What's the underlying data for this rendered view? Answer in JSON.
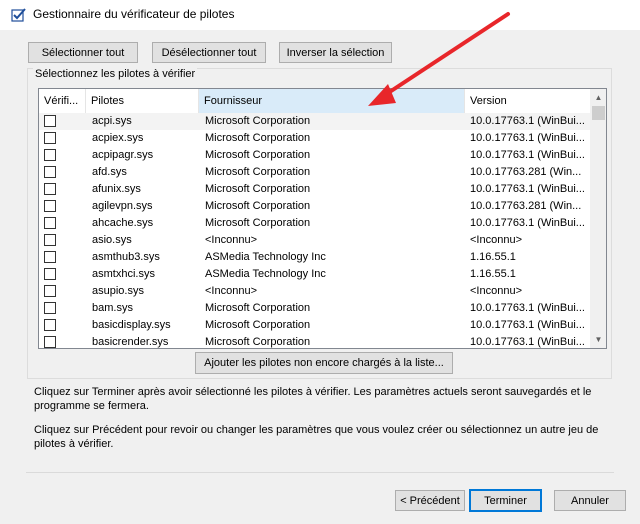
{
  "window": {
    "title": "Gestionnaire du vérificateur de pilotes"
  },
  "toolbar": {
    "select_all": "Sélectionner tout",
    "deselect_all": "Désélectionner tout",
    "invert": "Inverser la sélection"
  },
  "group": {
    "label": "Sélectionnez les pilotes à vérifier"
  },
  "table": {
    "columns": [
      "Vérifi...",
      "Pilotes",
      "Fournisseur",
      "Version"
    ],
    "rows": [
      {
        "checked": false,
        "driver": "acpi.sys",
        "vendor": "Microsoft Corporation",
        "version": "10.0.17763.1 (WinBui..."
      },
      {
        "checked": false,
        "driver": "acpiex.sys",
        "vendor": "Microsoft Corporation",
        "version": "10.0.17763.1 (WinBui..."
      },
      {
        "checked": false,
        "driver": "acpipagr.sys",
        "vendor": "Microsoft Corporation",
        "version": "10.0.17763.1 (WinBui..."
      },
      {
        "checked": false,
        "driver": "afd.sys",
        "vendor": "Microsoft Corporation",
        "version": "10.0.17763.281 (Win..."
      },
      {
        "checked": false,
        "driver": "afunix.sys",
        "vendor": "Microsoft Corporation",
        "version": "10.0.17763.1 (WinBui..."
      },
      {
        "checked": false,
        "driver": "agilevpn.sys",
        "vendor": "Microsoft Corporation",
        "version": "10.0.17763.281 (Win..."
      },
      {
        "checked": false,
        "driver": "ahcache.sys",
        "vendor": "Microsoft Corporation",
        "version": "10.0.17763.1 (WinBui..."
      },
      {
        "checked": false,
        "driver": "asio.sys",
        "vendor": "<Inconnu>",
        "version": "<Inconnu>"
      },
      {
        "checked": false,
        "driver": "asmthub3.sys",
        "vendor": "ASMedia Technology Inc",
        "version": "1.16.55.1"
      },
      {
        "checked": false,
        "driver": "asmtxhci.sys",
        "vendor": "ASMedia Technology Inc",
        "version": "1.16.55.1"
      },
      {
        "checked": false,
        "driver": "asupio.sys",
        "vendor": "<Inconnu>",
        "version": "<Inconnu>"
      },
      {
        "checked": false,
        "driver": "bam.sys",
        "vendor": "Microsoft Corporation",
        "version": "10.0.17763.1 (WinBui..."
      },
      {
        "checked": false,
        "driver": "basicdisplay.sys",
        "vendor": "Microsoft Corporation",
        "version": "10.0.17763.1 (WinBui..."
      },
      {
        "checked": false,
        "driver": "basicrender.sys",
        "vendor": "Microsoft Corporation",
        "version": "10.0.17763.1 (WinBui..."
      }
    ]
  },
  "add_unloaded": "Ajouter les pilotes non encore chargés à la liste...",
  "messages": {
    "finish": "Cliquez sur Terminer après avoir sélectionné les pilotes à vérifier. Les paramètres actuels seront sauvegardés et le programme se fermera.",
    "previous": "Cliquez sur Précédent pour revoir ou changer les paramètres que vous voulez créer ou sélectionnez un autre jeu de pilotes à vérifier."
  },
  "footer": {
    "previous": "< Précédent",
    "finish": "Terminer",
    "cancel": "Annuler"
  },
  "annotation": {
    "arrow_color": "#e8262a"
  },
  "icons": {
    "app": "driver-verifier-icon",
    "scroll_up": "scroll-up-icon",
    "scroll_down": "scroll-down-icon"
  }
}
